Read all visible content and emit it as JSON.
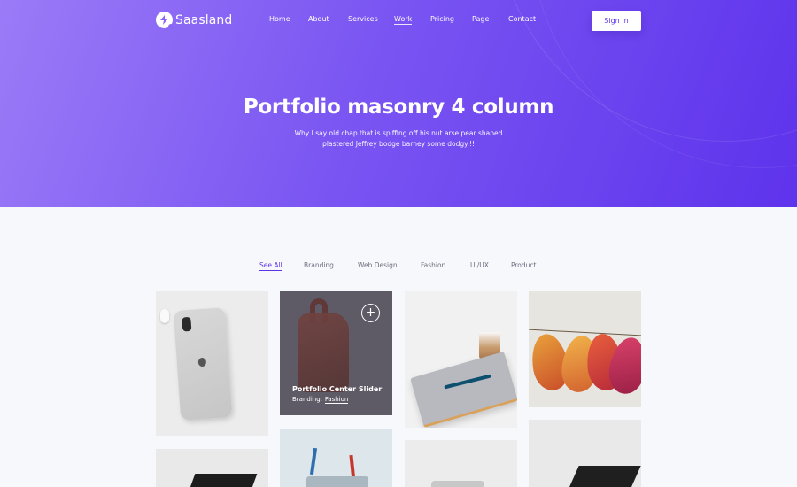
{
  "brand": {
    "name": "Saasland",
    "icon": "bolt-icon"
  },
  "nav": {
    "items": [
      {
        "label": "Home",
        "active": false
      },
      {
        "label": "About",
        "active": false
      },
      {
        "label": "Services",
        "active": false
      },
      {
        "label": "Work",
        "active": true
      },
      {
        "label": "Pricing",
        "active": false
      },
      {
        "label": "Page",
        "active": false
      },
      {
        "label": "Contact",
        "active": false
      }
    ],
    "signin_label": "Sign In"
  },
  "hero": {
    "title": "Portfolio masonry 4 column",
    "subtitle": "Why I say old chap that is spiffing off his nut arse pear shaped plastered Jeffrey bodge barney some dodgy.!!"
  },
  "filters": [
    {
      "label": "See All",
      "active": true
    },
    {
      "label": "Branding",
      "active": false
    },
    {
      "label": "Web Design",
      "active": false
    },
    {
      "label": "Fashion",
      "active": false
    },
    {
      "label": "UI/UX",
      "active": false
    },
    {
      "label": "Product",
      "active": false
    }
  ],
  "portfolio": {
    "hover_item": {
      "title": "Portfolio Center Slider",
      "category_1": "Branding,",
      "category_2": "Fashion",
      "action_icon": "plus-icon"
    }
  },
  "colors": {
    "accent": "#5e33ec",
    "hero_gradient_start": "#9b7bf7",
    "hero_gradient_end": "#5e33ec"
  }
}
